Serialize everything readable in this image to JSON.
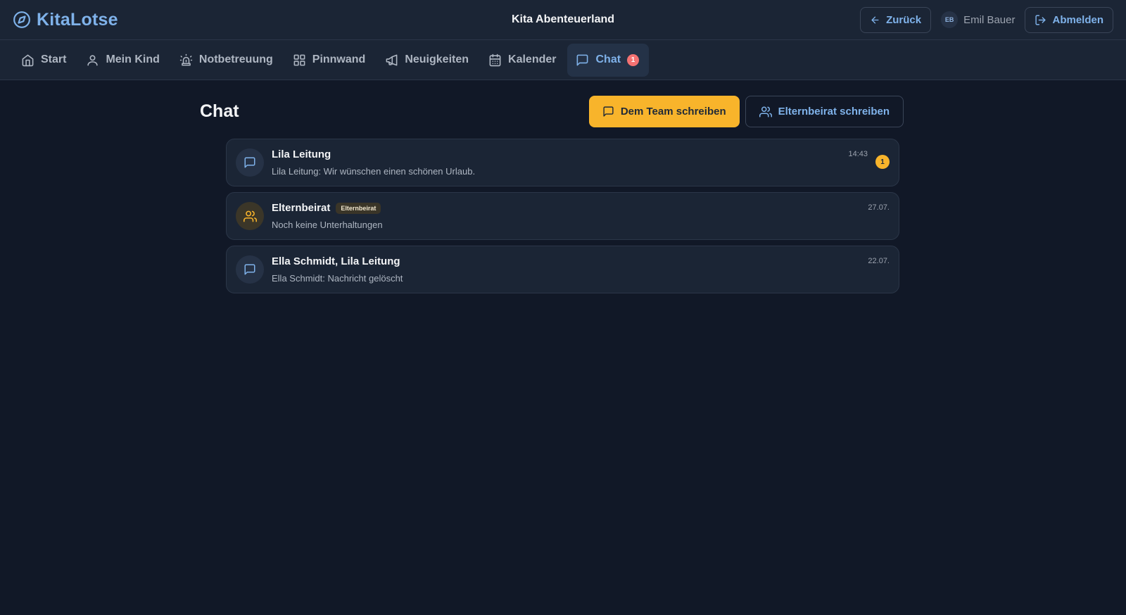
{
  "app": {
    "name": "KitaLotse",
    "logo_icon": "compass-icon"
  },
  "header": {
    "title": "Kita Abenteuerland",
    "back_label": "Zurück",
    "user": {
      "initials": "EB",
      "name": "Emil Bauer"
    },
    "logout_label": "Abmelden"
  },
  "nav": {
    "items": [
      {
        "label": "Start",
        "icon": "home-icon"
      },
      {
        "label": "Mein Kind",
        "icon": "user-icon"
      },
      {
        "label": "Notbetreuung",
        "icon": "siren-icon"
      },
      {
        "label": "Pinnwand",
        "icon": "grid-icon"
      },
      {
        "label": "Neuigkeiten",
        "icon": "megaphone-icon"
      },
      {
        "label": "Kalender",
        "icon": "calendar-icon"
      },
      {
        "label": "Chat",
        "icon": "chat-icon",
        "badge": "1",
        "active": true
      }
    ]
  },
  "main": {
    "title": "Chat",
    "team_button": "Dem Team schreiben",
    "council_button": "Elternbeirat schreiben"
  },
  "conversations": [
    {
      "title": "Lila Leitung",
      "preview": "Lila Leitung: Wir wünschen einen schönen Urlaub.",
      "time": "14:43",
      "unread": "1",
      "icon": "chat-icon"
    },
    {
      "title": "Elternbeirat",
      "tag": "Elternbeirat",
      "preview": "Noch keine Unterhaltungen",
      "time": "27.07.",
      "icon": "users-icon"
    },
    {
      "title": "Ella Schmidt, Lila Leitung",
      "preview": "Ella Schmidt: Nachricht gelöscht",
      "time": "22.07.",
      "icon": "chat-icon"
    }
  ],
  "colors": {
    "accent": "#7fb2ea",
    "primary": "#f8b42b",
    "background": "#111827",
    "surface": "#1b2535",
    "badge": "#f47272"
  }
}
